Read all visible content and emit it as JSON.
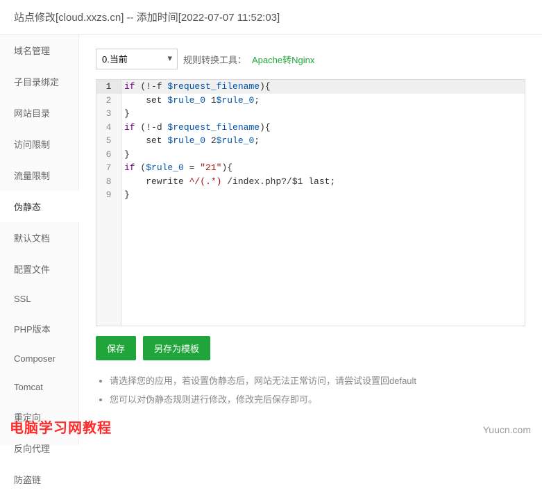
{
  "header": {
    "title": "站点修改[cloud.xxzs.cn] -- 添加时间[2022-07-07 11:52:03]"
  },
  "sidebar": {
    "items": [
      {
        "label": "域名管理"
      },
      {
        "label": "子目录绑定"
      },
      {
        "label": "网站目录"
      },
      {
        "label": "访问限制"
      },
      {
        "label": "流量限制"
      },
      {
        "label": "伪静态"
      },
      {
        "label": "默认文档"
      },
      {
        "label": "配置文件"
      },
      {
        "label": "SSL"
      },
      {
        "label": "PHP版本"
      },
      {
        "label": "Composer"
      },
      {
        "label": "Tomcat"
      },
      {
        "label": "重定向"
      },
      {
        "label": "反向代理"
      },
      {
        "label": "防盗链"
      }
    ],
    "active_index": 5
  },
  "toolbar": {
    "select_value": "0.当前",
    "convert_label": "规则转换工具：",
    "convert_link": "Apache转Nginx"
  },
  "code": {
    "lines": [
      {
        "n": 1,
        "segs": [
          {
            "t": "if",
            "c": "kw"
          },
          {
            "t": " (!-f ",
            "c": "plain"
          },
          {
            "t": "$request_filename",
            "c": "var"
          },
          {
            "t": "){",
            "c": "plain"
          }
        ]
      },
      {
        "n": 2,
        "segs": [
          {
            "t": "    set ",
            "c": "plain"
          },
          {
            "t": "$rule_0",
            "c": "var"
          },
          {
            "t": " 1",
            "c": "plain"
          },
          {
            "t": "$rule_0",
            "c": "var"
          },
          {
            "t": ";",
            "c": "plain"
          }
        ]
      },
      {
        "n": 3,
        "segs": [
          {
            "t": "}",
            "c": "plain"
          }
        ]
      },
      {
        "n": 4,
        "segs": [
          {
            "t": "if",
            "c": "kw"
          },
          {
            "t": " (!-d ",
            "c": "plain"
          },
          {
            "t": "$request_filename",
            "c": "var"
          },
          {
            "t": "){",
            "c": "plain"
          }
        ]
      },
      {
        "n": 5,
        "segs": [
          {
            "t": "    set ",
            "c": "plain"
          },
          {
            "t": "$rule_0",
            "c": "var"
          },
          {
            "t": " 2",
            "c": "plain"
          },
          {
            "t": "$rule_0",
            "c": "var"
          },
          {
            "t": ";",
            "c": "plain"
          }
        ]
      },
      {
        "n": 6,
        "segs": [
          {
            "t": "}",
            "c": "plain"
          }
        ]
      },
      {
        "n": 7,
        "segs": [
          {
            "t": "if",
            "c": "kw"
          },
          {
            "t": " (",
            "c": "plain"
          },
          {
            "t": "$rule_0",
            "c": "var"
          },
          {
            "t": " = ",
            "c": "plain"
          },
          {
            "t": "\"21\"",
            "c": "str"
          },
          {
            "t": "){",
            "c": "plain"
          }
        ]
      },
      {
        "n": 8,
        "segs": [
          {
            "t": "    rewrite ",
            "c": "plain"
          },
          {
            "t": "^/(.*)",
            "c": "str"
          },
          {
            "t": " /index.php?/$1 last;",
            "c": "plain"
          }
        ]
      },
      {
        "n": 9,
        "segs": [
          {
            "t": "}",
            "c": "plain"
          }
        ]
      }
    ],
    "active_line": 1
  },
  "buttons": {
    "save": "保存",
    "save_as": "另存为模板"
  },
  "tips": {
    "items": [
      "请选择您的应用，若设置伪静态后，网站无法正常访问，请尝试设置回default",
      "您可以对伪静态规则进行修改，修改完后保存即可。"
    ]
  },
  "watermark": {
    "left": "电脑学习网教程",
    "right": "Yuucn.com"
  }
}
